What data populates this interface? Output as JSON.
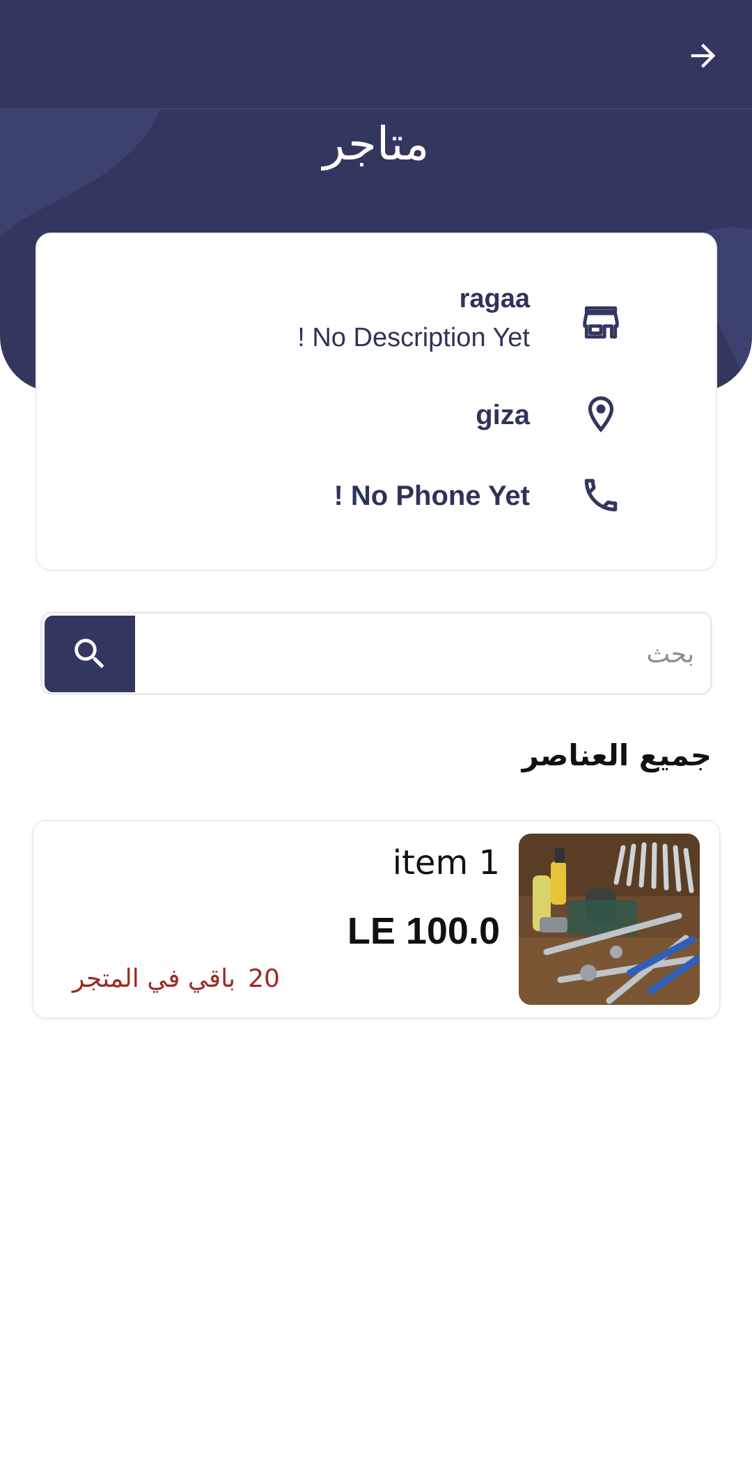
{
  "header": {
    "back_icon": "arrow-right-icon",
    "title": "متاجر"
  },
  "store": {
    "name": "ragaa",
    "description": "! No Description Yet",
    "location": "giza",
    "phone": "! No Phone Yet",
    "icons": [
      "store-icon",
      "location-pin-icon",
      "phone-icon"
    ]
  },
  "search": {
    "placeholder": "بحث",
    "value": "",
    "button_icon": "search-icon"
  },
  "section": {
    "title": "جميع العناصر"
  },
  "products": [
    {
      "name": "item 1",
      "price": "LE 100.0",
      "stock_count": "20",
      "stock_label": "باقي في المتجر"
    }
  ],
  "colors": {
    "primary": "#33375f",
    "stock_text": "#9b2a22",
    "background": "#ffffff"
  }
}
